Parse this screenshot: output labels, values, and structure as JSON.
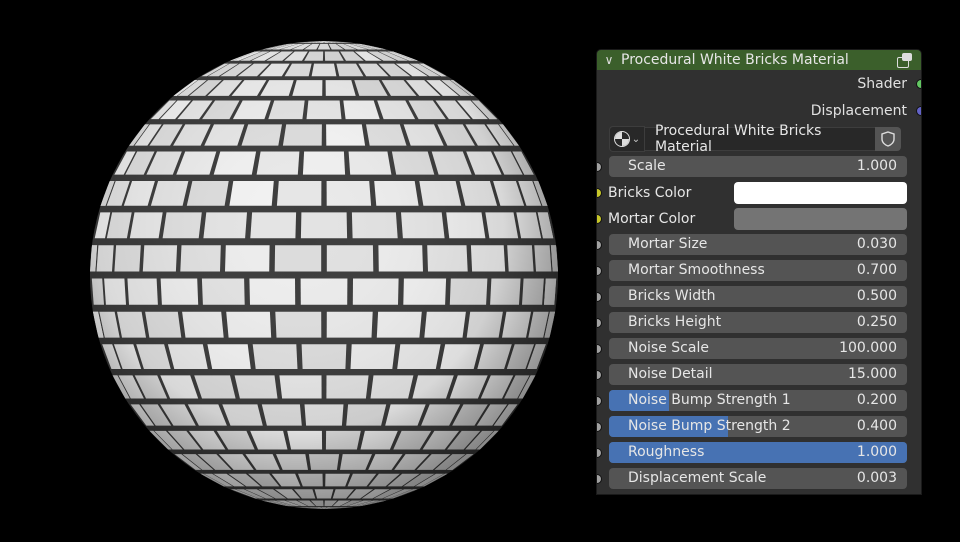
{
  "node": {
    "title": "Procedural White Bricks Material",
    "header_color": "#3b5f2b",
    "outputs": [
      {
        "label": "Shader",
        "socket": "sock-green"
      },
      {
        "label": "Displacement",
        "socket": "sock-purple"
      }
    ],
    "material_name": "Procedural White Bricks Material",
    "material_icon": "material-sphere-icon",
    "fake_user_icon": "shield-icon",
    "scale": {
      "label": "Scale",
      "value": "1.000"
    },
    "bricks_color": {
      "label": "Bricks Color",
      "color": "#ffffff"
    },
    "mortar_color": {
      "label": "Mortar Color",
      "color": "#747474"
    },
    "inputs": [
      {
        "label": "Mortar Size",
        "value": "0.030",
        "fill": 0
      },
      {
        "label": "Mortar Smoothness",
        "value": "0.700",
        "fill": 0
      },
      {
        "label": "Bricks Width",
        "value": "0.500",
        "fill": 0
      },
      {
        "label": "Bricks Height",
        "value": "0.250",
        "fill": 0
      },
      {
        "label": "Noise Scale",
        "value": "100.000",
        "fill": 0
      },
      {
        "label": "Noise Detail",
        "value": "15.000",
        "fill": 0
      },
      {
        "label": "Noise Bump Strength 1",
        "value": "0.200",
        "fill": 0.2
      },
      {
        "label": "Noise Bump Strength 2",
        "value": "0.400",
        "fill": 0.4
      },
      {
        "label": "Roughness",
        "value": "1.000",
        "fill": 1.0
      },
      {
        "label": "Displacement Scale",
        "value": "0.003",
        "fill": 0
      }
    ]
  },
  "preview": {
    "subject": "brick-sphere-preview"
  }
}
